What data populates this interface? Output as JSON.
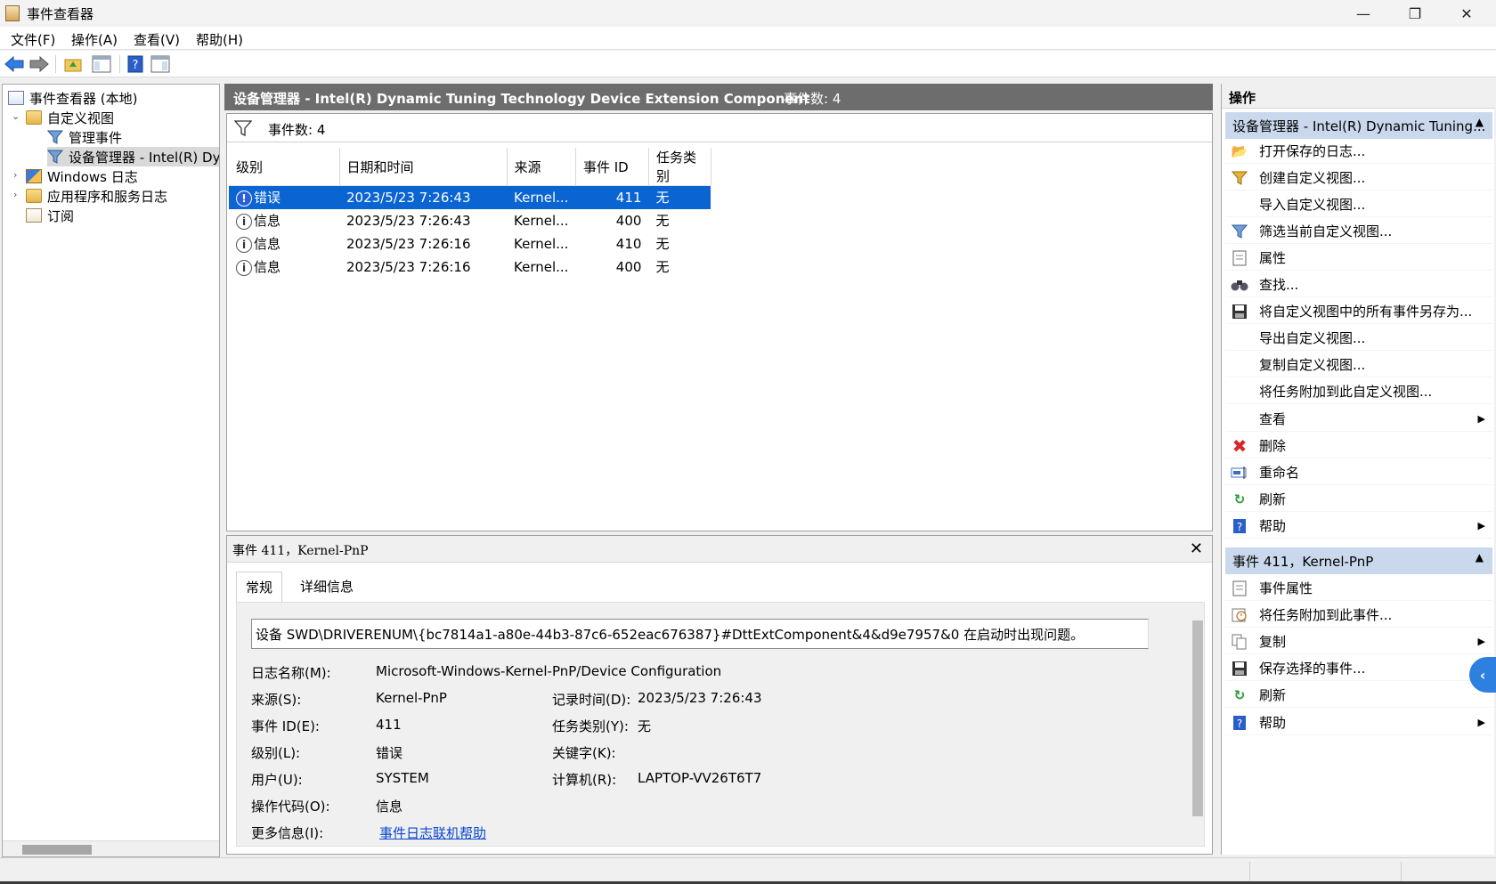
{
  "window": {
    "title": "事件查看器",
    "minimize": "—",
    "restore": "❐",
    "close": "✕"
  },
  "menu": [
    "文件(F)",
    "操作(A)",
    "查看(V)",
    "帮助(H)"
  ],
  "tree": {
    "root": "事件查看器 (本地)",
    "custom_views": "自定义视图",
    "admin_events": "管理事件",
    "device_manager": "设备管理器 - Intel(R) Dyı",
    "windows_logs": "Windows 日志",
    "app_service_logs": "应用程序和服务日志",
    "subscriptions": "订阅"
  },
  "center": {
    "header_title": "设备管理器 - Intel(R) Dynamic Tuning Technology Device Extension Component",
    "header_count": "事件数: 4",
    "filter_label": "事件数: 4",
    "columns": [
      "级别",
      "日期和时间",
      "来源",
      "事件 ID",
      "任务类别"
    ],
    "rows": [
      {
        "level": "错误",
        "level_type": "error",
        "datetime": "2023/5/23 7:26:43",
        "source": "Kernel...",
        "event_id": "411",
        "task": "无"
      },
      {
        "level": "信息",
        "level_type": "info",
        "datetime": "2023/5/23 7:26:43",
        "source": "Kernel...",
        "event_id": "400",
        "task": "无"
      },
      {
        "level": "信息",
        "level_type": "info",
        "datetime": "2023/5/23 7:26:16",
        "source": "Kernel...",
        "event_id": "410",
        "task": "无"
      },
      {
        "level": "信息",
        "level_type": "info",
        "datetime": "2023/5/23 7:26:16",
        "source": "Kernel...",
        "event_id": "400",
        "task": "无"
      }
    ]
  },
  "detail": {
    "title": "事件 411，Kernel-PnP",
    "close": "✕",
    "tabs": [
      "常规",
      "详细信息"
    ],
    "message": "设备 SWD\\DRIVERENUM\\{bc7814a1-a80e-44b3-87c6-652eac676387}#DttExtComponent&4&d9e7957&0 在启动时出现问题。",
    "fields": {
      "log_name_label": "日志名称(M):",
      "log_name": "Microsoft-Windows-Kernel-PnP/Device Configuration",
      "source_label": "来源(S):",
      "source": "Kernel-PnP",
      "logged_label": "记录时间(D):",
      "logged": "2023/5/23 7:26:43",
      "event_id_label": "事件 ID(E):",
      "event_id": "411",
      "task_label": "任务类别(Y):",
      "task": "无",
      "level_label": "级别(L):",
      "level": "错误",
      "keywords_label": "关键字(K):",
      "user_label": "用户(U):",
      "user": "SYSTEM",
      "computer_label": "计算机(R):",
      "computer": "LAPTOP-VV26T6T7",
      "opcode_label": "操作代码(O):",
      "opcode": "信息",
      "more_info_label": "更多信息(I):",
      "more_info_link": "事件日志联机帮助"
    }
  },
  "actions": {
    "header": "操作",
    "section1": "设备管理器 - Intel(R) Dynamic Tuning...",
    "items1": [
      "打开保存的日志...",
      "创建自定义视图...",
      "导入自定义视图...",
      "筛选当前自定义视图...",
      "属性",
      "查找...",
      "将自定义视图中的所有事件另存为...",
      "导出自定义视图...",
      "复制自定义视图...",
      "将任务附加到此自定义视图...",
      "查看",
      "删除",
      "重命名",
      "刷新",
      "帮助"
    ],
    "section2": "事件 411，Kernel-PnP",
    "items2": [
      "事件属性",
      "将任务附加到此事件...",
      "复制",
      "保存选择的事件...",
      "刷新",
      "帮助"
    ]
  }
}
